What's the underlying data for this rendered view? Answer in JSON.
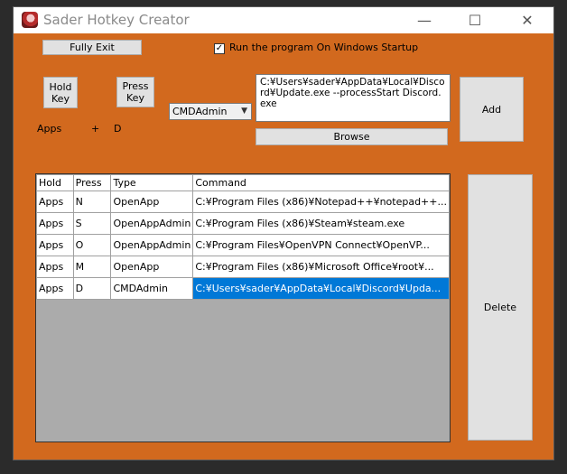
{
  "window": {
    "title": "Sader Hotkey Creator"
  },
  "title_controls": {
    "minimize": "—",
    "maximize": "☐",
    "close": "✕"
  },
  "toolbar": {
    "fully_exit": "Fully Exit",
    "startup_label": "Run the program On Windows Startup",
    "startup_checked": "✓"
  },
  "keys": {
    "hold_button": "Hold Key",
    "press_button": "Press Key",
    "hold_value": "Apps",
    "plus": "+",
    "press_value": "D"
  },
  "type_select": {
    "selected": "CMDAdmin"
  },
  "command_box": {
    "value": "C:¥Users¥sader¥AppData¥Local¥Discord¥Update.exe --processStart Discord.exe"
  },
  "buttons": {
    "browse": "Browse",
    "add": "Add",
    "delete": "Delete"
  },
  "table": {
    "headers": [
      "Hold",
      "Press",
      "Type",
      "Command"
    ],
    "rows": [
      [
        "Apps",
        "N",
        "OpenApp",
        "C:¥Program Files (x86)¥Notepad++¥notepad++..."
      ],
      [
        "Apps",
        "S",
        "OpenAppAdmin",
        "C:¥Program Files (x86)¥Steam¥steam.exe"
      ],
      [
        "Apps",
        "O",
        "OpenAppAdmin",
        "C:¥Program Files¥OpenVPN Connect¥OpenVP..."
      ],
      [
        "Apps",
        "M",
        "OpenApp",
        "C:¥Program Files (x86)¥Microsoft Office¥root¥..."
      ],
      [
        "Apps",
        "D",
        "CMDAdmin",
        "C:¥Users¥sader¥AppData¥Local¥Discord¥Upda..."
      ]
    ],
    "selected_row": 4
  },
  "colors": {
    "form_background": "#d2691e",
    "selection": "#0078d7"
  }
}
